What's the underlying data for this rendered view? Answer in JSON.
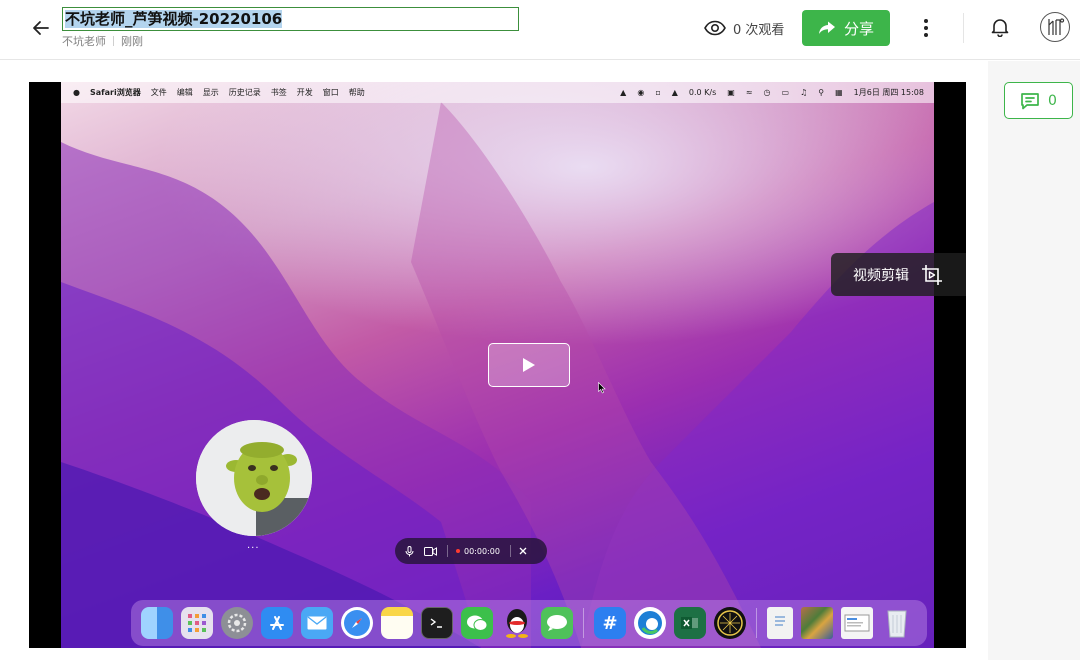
{
  "header": {
    "title": "不坑老师_芦笋视频-20220106",
    "author": "不坑老师",
    "time": "刚刚",
    "views_text": "0 次观看",
    "share_label": "分享"
  },
  "sidebar": {
    "comment_count": "0"
  },
  "video": {
    "edit_label": "视频剪辑",
    "menubar": {
      "app": "Safari浏览器",
      "items": [
        "文件",
        "编辑",
        "显示",
        "历史记录",
        "书签",
        "开发",
        "窗口",
        "帮助"
      ],
      "net_speed": "0.0 K/s",
      "datetime": "1月6日 周四 15:08"
    },
    "recorder": {
      "timer": "00:00:00"
    },
    "cam_dots": "...",
    "dock_apps": [
      "Finder",
      "Launchpad",
      "System Preferences",
      "App Store",
      "Mail",
      "Safari",
      "Notes",
      "Terminal",
      "WeChat",
      "QQ",
      "Messages",
      "Slack",
      "Edge",
      "Excel",
      "Compass",
      "Document",
      "Photos",
      "Preview",
      "Trash"
    ]
  }
}
